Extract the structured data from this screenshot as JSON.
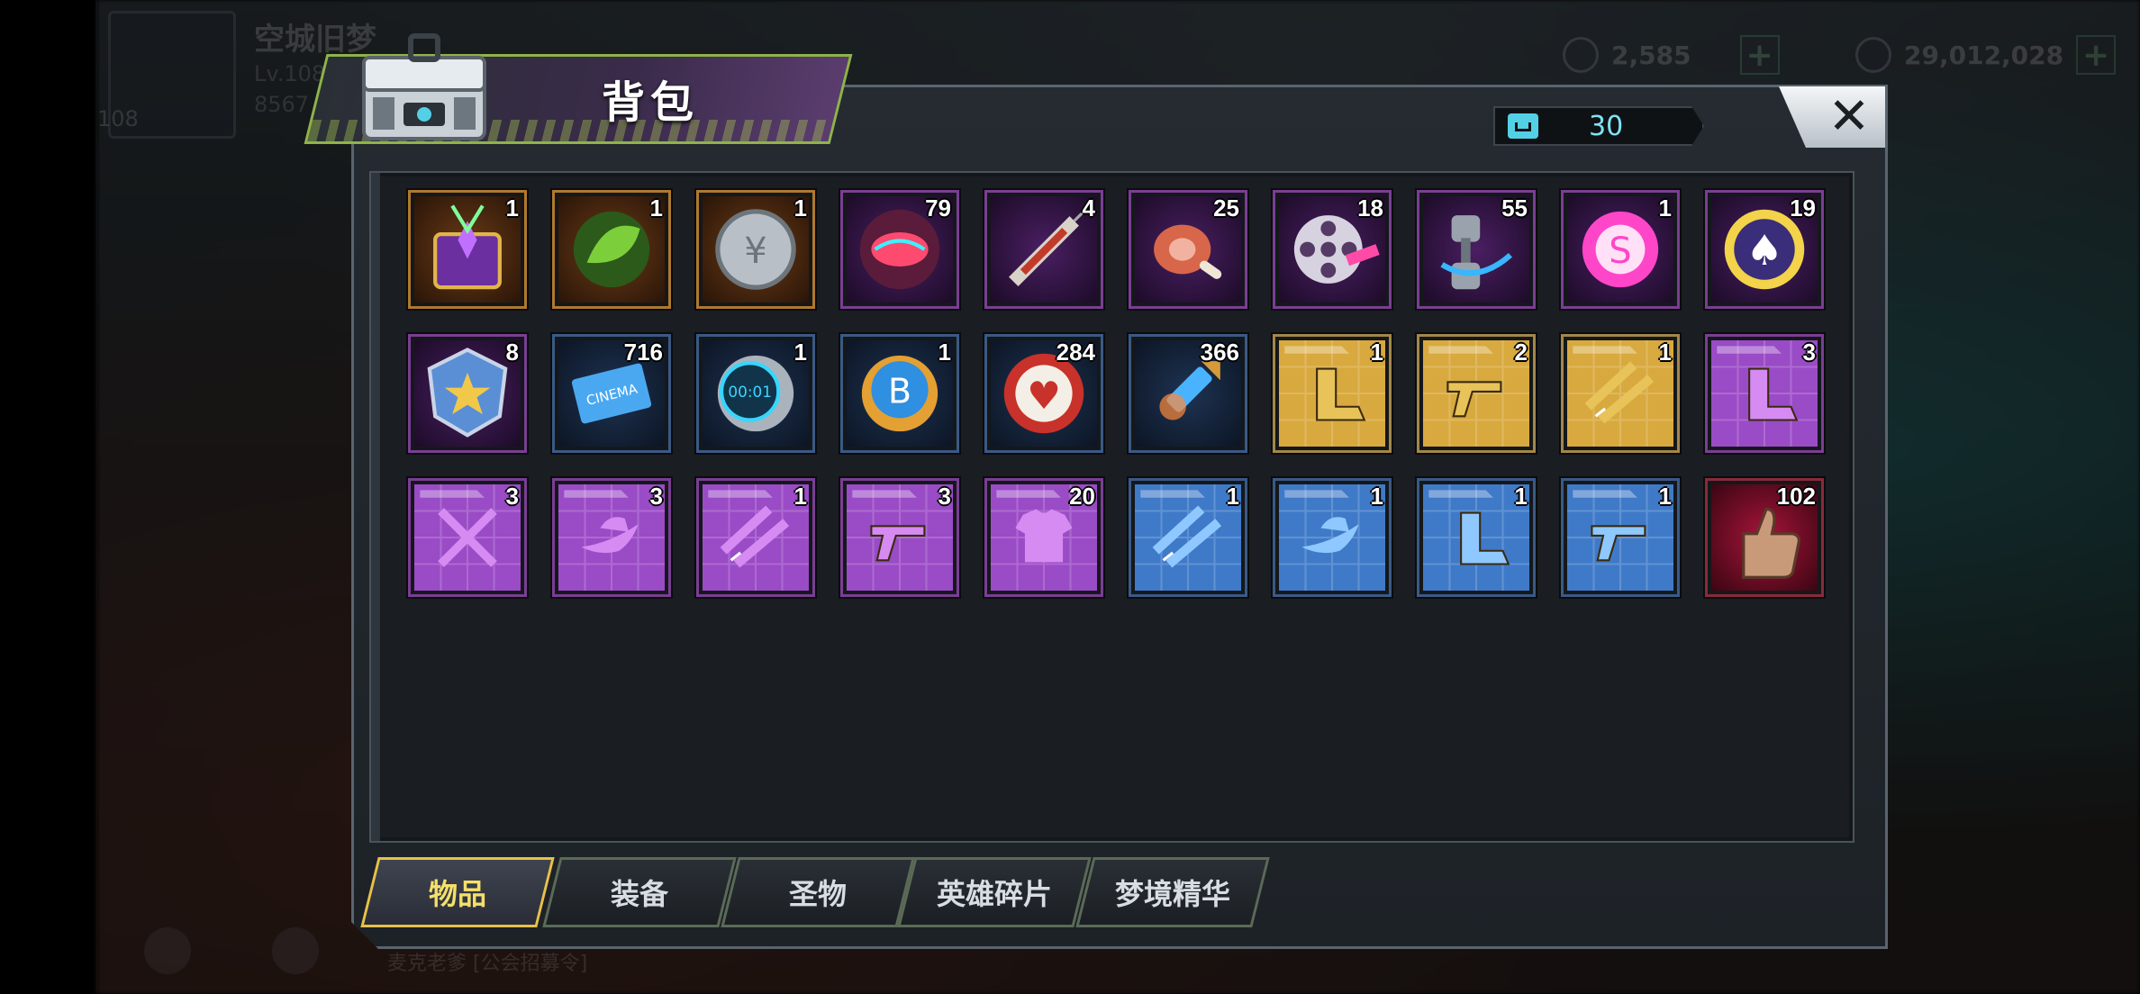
{
  "hud": {
    "player_name": "空城旧梦",
    "level": "Lv.108",
    "exp": "8567",
    "badge_level": "108",
    "gems": "2,585",
    "coins": "29,012,028",
    "plus": "+",
    "bottom_text": "麦克老爹 [公会招募令]"
  },
  "panel": {
    "title": "背包",
    "capacity": "30",
    "close_label": "✕"
  },
  "items": [
    {
      "icon": "mystery-chest-icon",
      "count": "1",
      "rarity": "orange"
    },
    {
      "icon": "green-leaf-icon",
      "count": "1",
      "rarity": "orange"
    },
    {
      "icon": "silver-coin-icon",
      "count": "1",
      "rarity": "orange"
    },
    {
      "icon": "neon-lips-cap-icon",
      "count": "79",
      "rarity": "purple"
    },
    {
      "icon": "syringe-icon",
      "count": "4",
      "rarity": "purple"
    },
    {
      "icon": "meat-leg-icon",
      "count": "25",
      "rarity": "purple"
    },
    {
      "icon": "film-reel-icon",
      "count": "18",
      "rarity": "purple"
    },
    {
      "icon": "dumbbell-icon",
      "count": "55",
      "rarity": "purple"
    },
    {
      "icon": "pink-cap-icon",
      "count": "1",
      "rarity": "purple"
    },
    {
      "icon": "poker-chip-spade-icon",
      "count": "19",
      "rarity": "purple"
    },
    {
      "icon": "police-badge-icon",
      "count": "8",
      "rarity": "purple"
    },
    {
      "icon": "cinema-ticket-icon",
      "count": "716",
      "rarity": "blue"
    },
    {
      "icon": "timer-coin-icon",
      "count": "1",
      "rarity": "blue"
    },
    {
      "icon": "blue-b-cap-icon",
      "count": "1",
      "rarity": "blue"
    },
    {
      "icon": "red-poker-chip-icon",
      "count": "284",
      "rarity": "blue"
    },
    {
      "icon": "bullet-icon",
      "count": "366",
      "rarity": "blue"
    },
    {
      "icon": "gold-boot-blueprint-icon",
      "count": "1",
      "rarity": "gold"
    },
    {
      "icon": "gold-revolver-blueprint-icon",
      "count": "2",
      "rarity": "gold"
    },
    {
      "icon": "gold-glasses-blueprint-icon",
      "count": "1",
      "rarity": "gold"
    },
    {
      "icon": "purple-boot-blueprint-icon",
      "count": "3",
      "rarity": "purple"
    },
    {
      "icon": "purple-swords-blueprint-icon",
      "count": "3",
      "rarity": "purple"
    },
    {
      "icon": "purple-hat-blueprint-icon",
      "count": "3",
      "rarity": "purple"
    },
    {
      "icon": "purple-glasses-blueprint-icon",
      "count": "1",
      "rarity": "purple"
    },
    {
      "icon": "purple-revolver-blueprint-icon",
      "count": "3",
      "rarity": "purple"
    },
    {
      "icon": "purple-tshirt-blueprint-icon",
      "count": "20",
      "rarity": "purple"
    },
    {
      "icon": "blue-glasses-blueprint-icon",
      "count": "1",
      "rarity": "blue"
    },
    {
      "icon": "blue-hat-blueprint-icon",
      "count": "1",
      "rarity": "blue"
    },
    {
      "icon": "blue-boot-blueprint-icon",
      "count": "1",
      "rarity": "blue"
    },
    {
      "icon": "blue-revolver-blueprint-icon",
      "count": "1",
      "rarity": "blue"
    },
    {
      "icon": "thumbs-up-icon",
      "count": "102",
      "rarity": "red"
    }
  ],
  "tabs": [
    {
      "label": "物品",
      "active": true
    },
    {
      "label": "装备",
      "active": false
    },
    {
      "label": "圣物",
      "active": false
    },
    {
      "label": "英雄碎片",
      "active": false
    },
    {
      "label": "梦境精华",
      "active": false
    }
  ],
  "colors": {
    "accent_gold": "#e7c14b",
    "accent_green": "#8fb34a",
    "capacity_cyan": "#7fe3f3"
  }
}
